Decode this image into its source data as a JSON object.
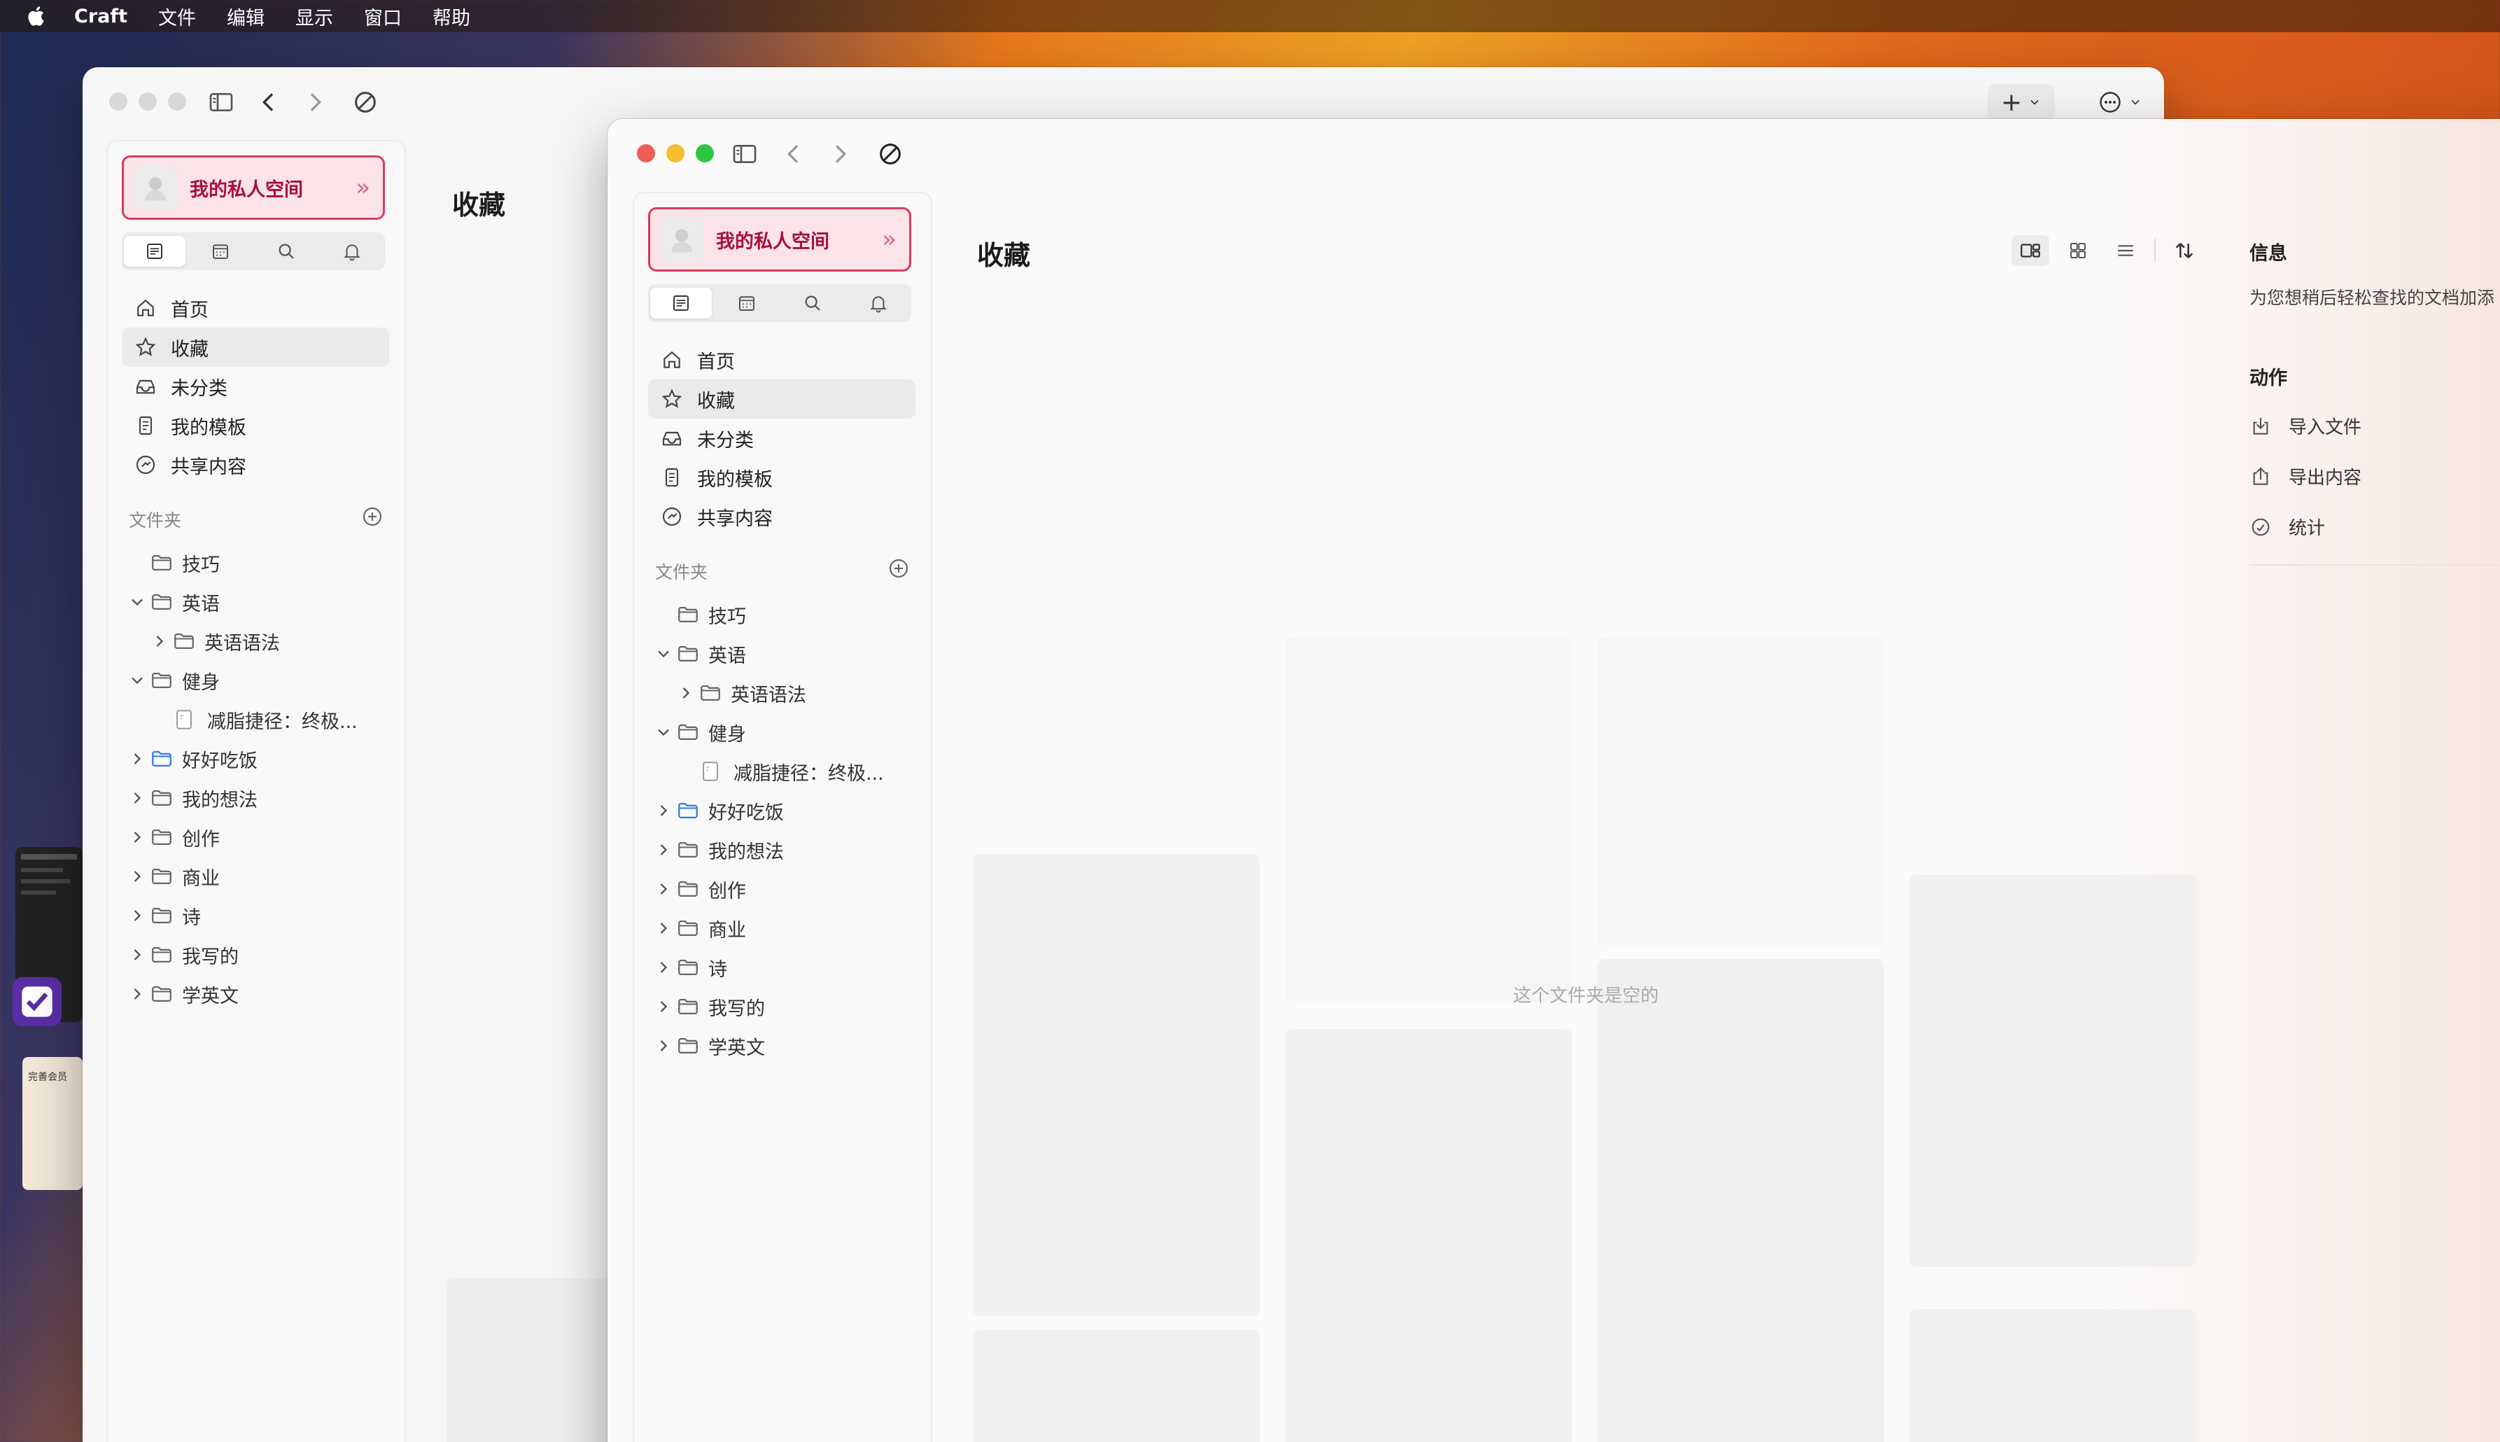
{
  "menubar": {
    "app_name": "Craft",
    "items": [
      "文件",
      "编辑",
      "显示",
      "窗口",
      "帮助"
    ]
  },
  "back_window": {
    "space_name": "我的私人空间",
    "page_title": "收藏",
    "toolbar": {
      "new_button": "+",
      "more_button": "⋯"
    }
  },
  "front_window": {
    "space_name": "我的私人空间",
    "page_title": "收藏",
    "empty_message": "这个文件夹是空的",
    "view_modes": [
      "card-view",
      "grid-view",
      "list-view"
    ]
  },
  "sidebar": {
    "nav": [
      {
        "label": "首页",
        "icon": "home-icon",
        "active": false
      },
      {
        "label": "收藏",
        "icon": "star-icon",
        "active": true
      },
      {
        "label": "未分类",
        "icon": "inbox-icon",
        "active": false
      },
      {
        "label": "我的模板",
        "icon": "template-icon",
        "active": false
      },
      {
        "label": "共享内容",
        "icon": "share-icon",
        "active": false
      }
    ],
    "folders_header": "文件夹",
    "folders": [
      {
        "label": "技巧",
        "level": 0,
        "caret": "none",
        "type": "folder"
      },
      {
        "label": "英语",
        "level": 0,
        "caret": "down",
        "type": "folder"
      },
      {
        "label": "英语语法",
        "level": 1,
        "caret": "right",
        "type": "folder"
      },
      {
        "label": "健身",
        "level": 0,
        "caret": "down",
        "type": "folder"
      },
      {
        "label": "减脂捷径：终极...",
        "level": 1,
        "caret": "none",
        "type": "doc"
      },
      {
        "label": "好好吃饭",
        "level": 0,
        "caret": "right",
        "type": "folder-blue"
      },
      {
        "label": "我的想法",
        "level": 0,
        "caret": "right",
        "type": "folder"
      },
      {
        "label": "创作",
        "level": 0,
        "caret": "right",
        "type": "folder"
      },
      {
        "label": "商业",
        "level": 0,
        "caret": "right",
        "type": "folder"
      },
      {
        "label": "诗",
        "level": 0,
        "caret": "right",
        "type": "folder"
      },
      {
        "label": "我写的",
        "level": 0,
        "caret": "right",
        "type": "folder"
      },
      {
        "label": "学英文",
        "level": 0,
        "caret": "right",
        "type": "folder"
      }
    ]
  },
  "info_panel": {
    "title": "信息",
    "description": "为您想稍后轻松查找的文档加添",
    "actions_title": "动作",
    "actions": [
      {
        "label": "导入文件",
        "icon": "import-icon"
      },
      {
        "label": "导出内容",
        "icon": "export-icon"
      },
      {
        "label": "统计",
        "icon": "stats-icon"
      }
    ]
  },
  "colors": {
    "accent": "#d63d5c",
    "accent_text": "#a8103a",
    "traffic_red": "#ee5e55",
    "traffic_yellow": "#f5bd2f",
    "traffic_green": "#2dc840"
  },
  "dock_peek": {
    "label": "完善会员"
  }
}
